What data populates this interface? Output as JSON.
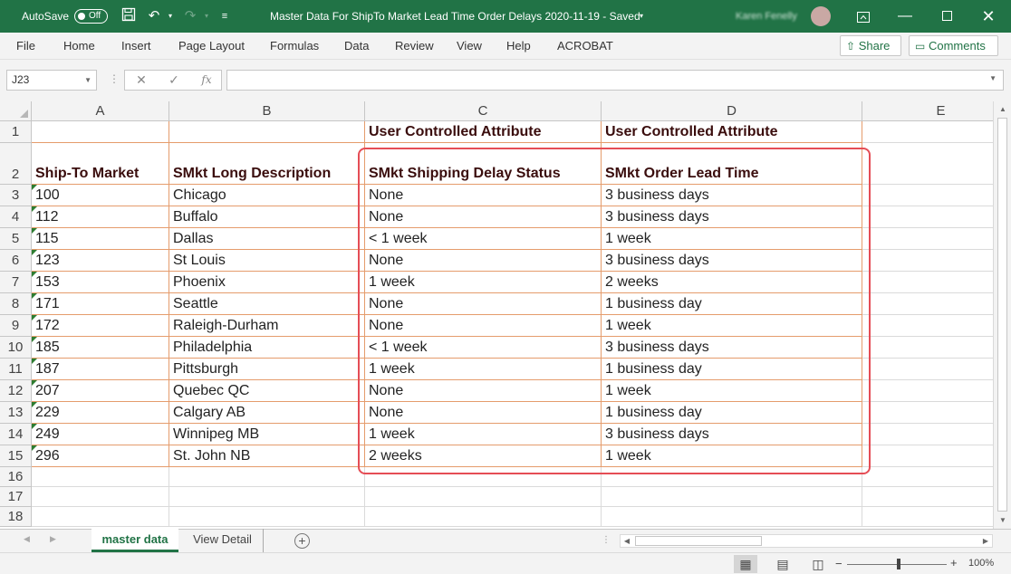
{
  "titlebar": {
    "autosave_label": "AutoSave",
    "autosave_state": "Off",
    "document_title": "Master Data For ShipTo Market Lead Time Order Delays  2020-11-19  -  Saved",
    "user_name": "Karen Fenelly",
    "icons": [
      "save-icon",
      "undo-icon",
      "redo-icon",
      "customize-qat-icon",
      "ribbon-display-icon",
      "minimize-icon",
      "restore-icon",
      "close-icon"
    ]
  },
  "menu": {
    "items": [
      "File",
      "Home",
      "Insert",
      "Page Layout",
      "Formulas",
      "Data",
      "Review",
      "View",
      "Help",
      "ACROBAT"
    ],
    "share_label": "Share",
    "comments_label": "Comments"
  },
  "formula_bar": {
    "name_box": "J23",
    "fx_label": "fx",
    "formula": ""
  },
  "sheet": {
    "columns": [
      "A",
      "B",
      "C",
      "D",
      "E"
    ],
    "row1": {
      "A": "",
      "B": "",
      "C": "User Controlled Attribute",
      "D": "User Controlled Attribute"
    },
    "row2": {
      "A": "Ship-To Market",
      "B": "SMkt Long Description",
      "C": "SMkt Shipping Delay Status",
      "D": "SMkt Order Lead Time"
    },
    "rows": [
      {
        "num": "3",
        "A": "100",
        "B": "Chicago",
        "C": "None",
        "D": "3 business days"
      },
      {
        "num": "4",
        "A": "112",
        "B": "Buffalo",
        "C": "None",
        "D": "3 business days"
      },
      {
        "num": "5",
        "A": "115",
        "B": "Dallas",
        "C": "< 1 week",
        "D": "1 week"
      },
      {
        "num": "6",
        "A": "123",
        "B": "St Louis",
        "C": "None",
        "D": "3 business days"
      },
      {
        "num": "7",
        "A": "153",
        "B": "Phoenix",
        "C": "1 week",
        "D": "2 weeks"
      },
      {
        "num": "8",
        "A": "171",
        "B": "Seattle",
        "C": "None",
        "D": "1 business day"
      },
      {
        "num": "9",
        "A": "172",
        "B": "Raleigh-Durham",
        "C": "None",
        "D": "1 week"
      },
      {
        "num": "10",
        "A": "185",
        "B": "Philadelphia",
        "C": "< 1 week",
        "D": "3 business days"
      },
      {
        "num": "11",
        "A": "187",
        "B": "Pittsburgh",
        "C": "1 week",
        "D": "1 business day"
      },
      {
        "num": "12",
        "A": "207",
        "B": "Quebec QC",
        "C": "None",
        "D": "1 week"
      },
      {
        "num": "13",
        "A": "229",
        "B": "Calgary AB",
        "C": "None",
        "D": "1 business day"
      },
      {
        "num": "14",
        "A": "249",
        "B": "Winnipeg MB",
        "C": "1 week",
        "D": "3 business days"
      },
      {
        "num": "15",
        "A": "296",
        "B": "St. John NB",
        "C": "2 weeks",
        "D": "1 week"
      }
    ],
    "empty_rows": [
      "16",
      "17",
      "18"
    ],
    "highlight_color": "#e54d55"
  },
  "tabs": {
    "sheets": [
      "master data",
      "View Detail"
    ],
    "active": "master data"
  },
  "status": {
    "zoom": "100%",
    "zoom_out": "−",
    "zoom_in": "+"
  }
}
